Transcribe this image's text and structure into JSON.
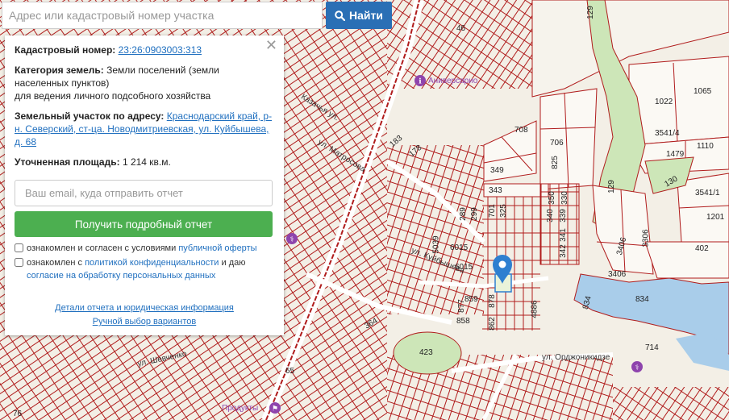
{
  "search": {
    "placeholder": "Адрес или кадастровый номер участка",
    "button_label": "Найти"
  },
  "panel": {
    "cadastral_label": "Кадастровый номер:",
    "cadastral_value": "23:26:0903003:313",
    "category_label": "Категория земель:",
    "category_value": "Земли поселений (земли населенных пунктов)",
    "category_use": "для ведения личного подсобного хозяйства",
    "address_label": "Земельный участок по адресу:",
    "address_value": "Краснодарский край, р-н. Северский, ст-ца. Новодмитриевская, ул. Куйбышева, д. 68",
    "area_label": "Уточненная площадь:",
    "area_value": "1 214 кв.м.",
    "email_placeholder": "Ваш email, куда отправить отчет",
    "report_button": "Получить подробный отчет",
    "check1_text": "ознакомлен и согласен с условиями",
    "check1_link": "публичной оферты",
    "check2_text": "ознакомлен с",
    "check2_link": "политикой конфиденциальности",
    "check2_mid": "и даю",
    "check2_link2": "согласие на обработку персональных данных",
    "details_link": "Детали отчета и юридическая информация",
    "manual_link": "Ручной выбор вариантов"
  },
  "map": {
    "parcel_labels": [
      "46",
      "1022",
      "1065",
      "3541/4",
      "1479",
      "1110",
      "130",
      "3541/1",
      "1201",
      "402",
      "129",
      "129",
      "708",
      "706",
      "825",
      "349",
      "343",
      "350",
      "330",
      "340",
      "339",
      "341",
      "342",
      "289",
      "299",
      "701",
      "325",
      "6015",
      "6015",
      "5039",
      "877",
      "859",
      "878",
      "862",
      "858",
      "4886",
      "3406",
      "3406",
      "3306",
      "834",
      "834",
      "714",
      "423",
      "364",
      "65",
      "76",
      "183",
      "178"
    ],
    "streets": [
      "ул. Куйбышева",
      "ул. Орджоникидзе",
      "ул. Шевченко",
      "ул. Матросова",
      "Казачья ул."
    ],
    "pois": [
      "Аниверсарио",
      "Продукты"
    ],
    "colors": {
      "parcel_stroke": "#b01c1c",
      "water": "#a9cdea",
      "green": "#cde6b8",
      "pin": "#2e7fd0"
    }
  }
}
